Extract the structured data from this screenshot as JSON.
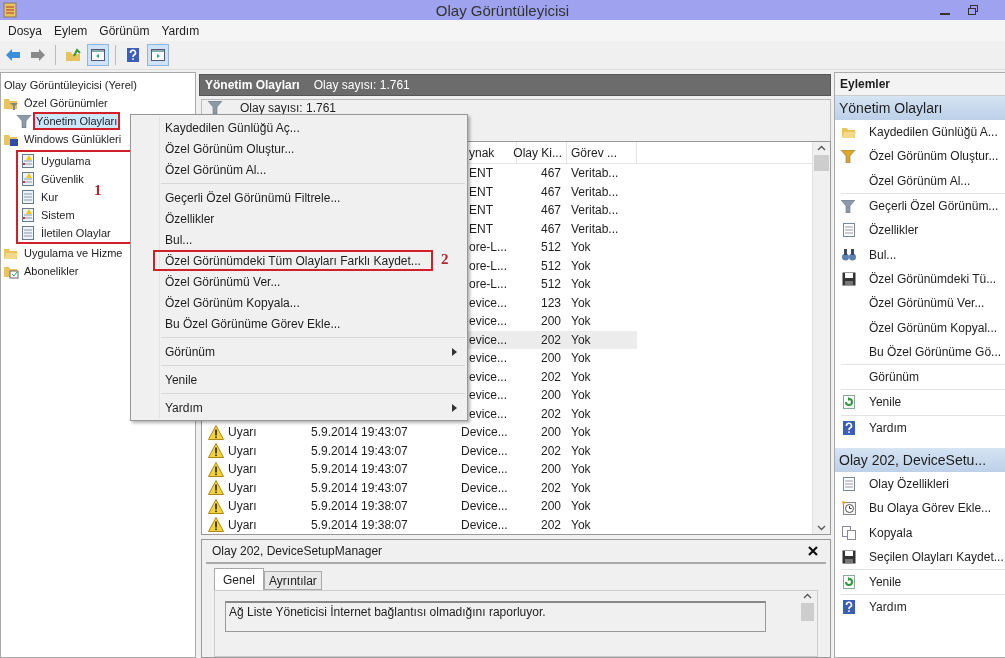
{
  "window": {
    "title": "Olay Görüntüleyicisi"
  },
  "menu_bar": [
    "Dosya",
    "Eylem",
    "Görünüm",
    "Yardım"
  ],
  "toolbar": [
    {
      "kind": "back",
      "pressed": false
    },
    {
      "kind": "forward",
      "pressed": false
    },
    {
      "kind": "up",
      "pressed": false
    },
    {
      "kind": "tree",
      "pressed": true
    },
    {
      "kind": "help",
      "pressed": false
    },
    {
      "kind": "pane",
      "pressed": true
    }
  ],
  "tree": {
    "label": "Olay Görüntüleyicisi (Yerel)",
    "children": [
      {
        "label": "Özel Görünümler",
        "kind": "filter-folder",
        "children": [
          {
            "label": "Yönetim Olayları",
            "kind": "filter",
            "selected": true,
            "framed": true
          }
        ]
      },
      {
        "label": "Windows Günlükleri",
        "kind": "logs-folder",
        "children_framed": true,
        "note": "1",
        "children": [
          {
            "label": "Uygulama",
            "kind": "log-warn",
            "selected": false
          },
          {
            "label": "Güvenlik",
            "kind": "log-warn",
            "selected": false
          },
          {
            "label": "Kur",
            "kind": "log",
            "selected": false
          },
          {
            "label": "Sistem",
            "kind": "log-warn",
            "selected": false
          },
          {
            "label": "İletilen Olaylar",
            "kind": "log",
            "selected": false
          }
        ]
      },
      {
        "label": "Uygulama ve Hizme",
        "kind": "folder"
      },
      {
        "label": "Abonelikler",
        "kind": "subs-folder"
      }
    ]
  },
  "content": {
    "title": "Yönetim Olayları",
    "count": "Olay sayısı: 1.761",
    "filter_text": "Olay sayısı: 1.761",
    "table": {
      "columns": [
        "ynak",
        "Olay Ki...",
        "Görev ..."
      ],
      "rows": [
        {
          "source": "ENT",
          "id": "467",
          "task": "Veritab...",
          "selected": false
        },
        {
          "source": "ENT",
          "id": "467",
          "task": "Veritab...",
          "selected": false
        },
        {
          "source": "ENT",
          "id": "467",
          "task": "Veritab...",
          "selected": false
        },
        {
          "source": "ENT",
          "id": "467",
          "task": "Veritab...",
          "selected": false
        },
        {
          "source": "ore-L...",
          "id": "512",
          "task": "Yok",
          "selected": false
        },
        {
          "source": "ore-L...",
          "id": "512",
          "task": "Yok",
          "selected": false
        },
        {
          "source": "ore-L...",
          "id": "512",
          "task": "Yok",
          "selected": false
        },
        {
          "source": "evice...",
          "id": "123",
          "task": "Yok",
          "selected": false
        },
        {
          "source": "evice...",
          "id": "200",
          "task": "Yok",
          "selected": false
        },
        {
          "source": "evice...",
          "id": "202",
          "task": "Yok",
          "selected": true
        },
        {
          "source": "evice...",
          "id": "200",
          "task": "Yok",
          "selected": false
        },
        {
          "source": "evice...",
          "id": "202",
          "task": "Yok",
          "selected": false
        },
        {
          "source": "evice...",
          "id": "200",
          "task": "Yok",
          "selected": false
        },
        {
          "source": "evice...",
          "id": "202",
          "task": "Yok",
          "selected": false
        },
        {
          "level": "Uyarı",
          "date": "5.9.2014 19:43:07",
          "source": "Device...",
          "id": "200",
          "task": "Yok",
          "selected": false
        },
        {
          "level": "Uyarı",
          "date": "5.9.2014 19:43:07",
          "source": "Device...",
          "id": "202",
          "task": "Yok",
          "selected": false
        },
        {
          "level": "Uyarı",
          "date": "5.9.2014 19:43:07",
          "source": "Device...",
          "id": "200",
          "task": "Yok",
          "selected": false
        },
        {
          "level": "Uyarı",
          "date": "5.9.2014 19:43:07",
          "source": "Device...",
          "id": "202",
          "task": "Yok",
          "selected": false
        },
        {
          "level": "Uyarı",
          "date": "5.9.2014 19:38:07",
          "source": "Device...",
          "id": "200",
          "task": "Yok",
          "selected": false
        },
        {
          "level": "Uyarı",
          "date": "5.9.2014 19:38:07",
          "source": "Device...",
          "id": "202",
          "task": "Yok",
          "selected": false
        }
      ]
    }
  },
  "detail": {
    "title": "Olay 202, DeviceSetupManager",
    "tabs": [
      {
        "label": "Genel",
        "selected": true
      },
      {
        "label": "Ayrıntılar",
        "selected": false
      }
    ],
    "message": "Ağ Liste Yöneticisi İnternet bağlantısı olmadığını raporluyor."
  },
  "context_menu": {
    "groups": [
      [
        {
          "label": "Kaydedilen Günlüğü Aç...",
          "submenu": false
        },
        {
          "label": "Özel Görünüm Oluştur...",
          "submenu": false
        },
        {
          "label": "Özel Görünüm Al...",
          "submenu": false
        }
      ],
      [
        {
          "label": "Geçerli Özel Görünümü Filtrele...",
          "submenu": false
        },
        {
          "label": "Özellikler",
          "submenu": false
        },
        {
          "label": "Bul...",
          "submenu": false
        },
        {
          "label": "Özel Görünümdeki Tüm Olayları Farklı Kaydet...",
          "submenu": false,
          "framed": true,
          "note": "2"
        },
        {
          "label": "Özel Görünümü Ver...",
          "submenu": false
        },
        {
          "label": "Özel Görünüm Kopyala...",
          "submenu": false
        },
        {
          "label": "Bu Özel Görünüme Görev Ekle...",
          "submenu": false
        }
      ],
      [
        {
          "label": "Görünüm",
          "submenu": true
        }
      ],
      [
        {
          "label": "Yenile",
          "submenu": false
        }
      ],
      [
        {
          "label": "Yardım",
          "submenu": true
        }
      ]
    ]
  },
  "actions": {
    "title": "Eylemler",
    "sections": [
      {
        "title": "Yönetim Olayları",
        "groups": [
          [
            {
              "label": "Kaydedilen Günlüğü A...",
              "kind": "folder"
            },
            {
              "label": "Özel Görünüm Oluştur...",
              "kind": "filter-new"
            },
            {
              "label": "Özel Görünüm Al...",
              "kind": "none"
            }
          ],
          [
            {
              "label": "Geçerli Özel Görünüm...",
              "kind": "filter"
            },
            {
              "label": "Özellikler",
              "kind": "properties"
            },
            {
              "label": "Bul...",
              "kind": "find"
            },
            {
              "label": "Özel Görünümdeki Tü...",
              "kind": "disk"
            },
            {
              "label": "Özel Görünümü Ver...",
              "kind": "none"
            },
            {
              "label": "Özel Görünüm Kopyal...",
              "kind": "none"
            },
            {
              "label": "Bu Özel Görünüme Gö...",
              "kind": "none"
            }
          ],
          [
            {
              "label": "Görünüm",
              "kind": "none"
            }
          ],
          [
            {
              "label": "Yenile",
              "kind": "refresh"
            }
          ],
          [
            {
              "label": "Yardım",
              "kind": "help"
            }
          ]
        ]
      },
      {
        "title": "Olay 202, DeviceSetu...",
        "groups": [
          [
            {
              "label": "Olay Özellikleri",
              "kind": "properties"
            },
            {
              "label": "Bu Olaya Görev Ekle...",
              "kind": "task"
            },
            {
              "label": "Kopyala",
              "kind": "copy"
            },
            {
              "label": "Seçilen Olayları Kaydet...",
              "kind": "disk"
            }
          ],
          [
            {
              "label": "Yenile",
              "kind": "refresh"
            }
          ],
          [
            {
              "label": "Yardım",
              "kind": "help"
            }
          ]
        ]
      }
    ]
  }
}
